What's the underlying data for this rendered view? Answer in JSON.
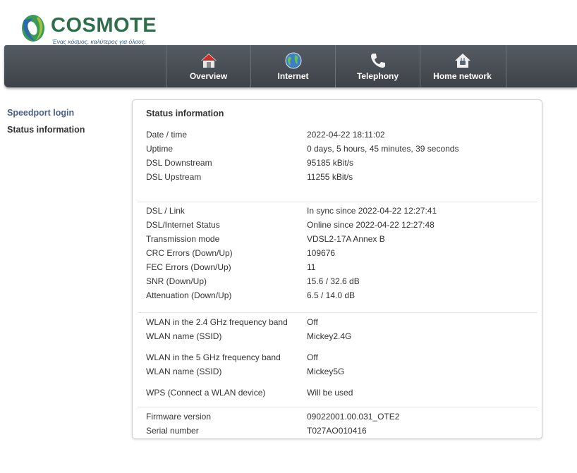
{
  "brand": {
    "name": "COSMOTE",
    "tagline": "Ένας κόσμος, καλύτερος για όλους."
  },
  "nav": [
    {
      "label": "Overview",
      "icon": "house-icon"
    },
    {
      "label": "Internet",
      "icon": "globe-icon"
    },
    {
      "label": "Telephony",
      "icon": "phone-icon"
    },
    {
      "label": "Home network",
      "icon": "home-network-icon"
    }
  ],
  "sidebar": {
    "login": "Speedport login",
    "status": "Status information"
  },
  "panel": {
    "title": "Status information",
    "general": [
      {
        "label": "Date / time",
        "value": "2022-04-22 18:11:02"
      },
      {
        "label": "Uptime",
        "value": "0 days, 5 hours, 45 minutes, 39 seconds"
      },
      {
        "label": "DSL Downstream",
        "value": "95185 kBit/s"
      },
      {
        "label": "DSL Upstream",
        "value": "11255 kBit/s"
      }
    ],
    "dsl": [
      {
        "label": "DSL / Link",
        "value": "In sync since 2022-04-22 12:27:41"
      },
      {
        "label": "DSL/Internet Status",
        "value": "Online since 2022-04-22 12:27:48"
      },
      {
        "label": "Transmission mode",
        "value": "VDSL2-17A Annex B"
      },
      {
        "label": "CRC Errors (Down/Up)",
        "value": "109676"
      },
      {
        "label": "FEC Errors (Down/Up)",
        "value": "11"
      },
      {
        "label": "SNR (Down/Up)",
        "value": "15.6 / 32.6 dB"
      },
      {
        "label": "Attenuation (Down/Up)",
        "value": "6.5 / 14.0 dB"
      }
    ],
    "wlan": [
      {
        "label": "WLAN in the 2.4 GHz frequency band",
        "value": "Off"
      },
      {
        "label": "WLAN name (SSID)",
        "value": "Mickey2.4G"
      },
      {
        "label": "WLAN in the 5 GHz frequency band",
        "value": "Off"
      },
      {
        "label": "WLAN name (SSID)",
        "value": "Mickey5G"
      },
      {
        "label": "WPS (Connect a WLAN device)",
        "value": "Will be used"
      }
    ],
    "device": [
      {
        "label": "Firmware version",
        "value": "09022001.00.031_OTE2"
      },
      {
        "label": "Serial number",
        "value": "T027AO010416"
      }
    ]
  },
  "colors": {
    "brand_green": "#2f6e4a",
    "nav_bg": "#484e54",
    "link_blue": "#4a5f8c"
  }
}
